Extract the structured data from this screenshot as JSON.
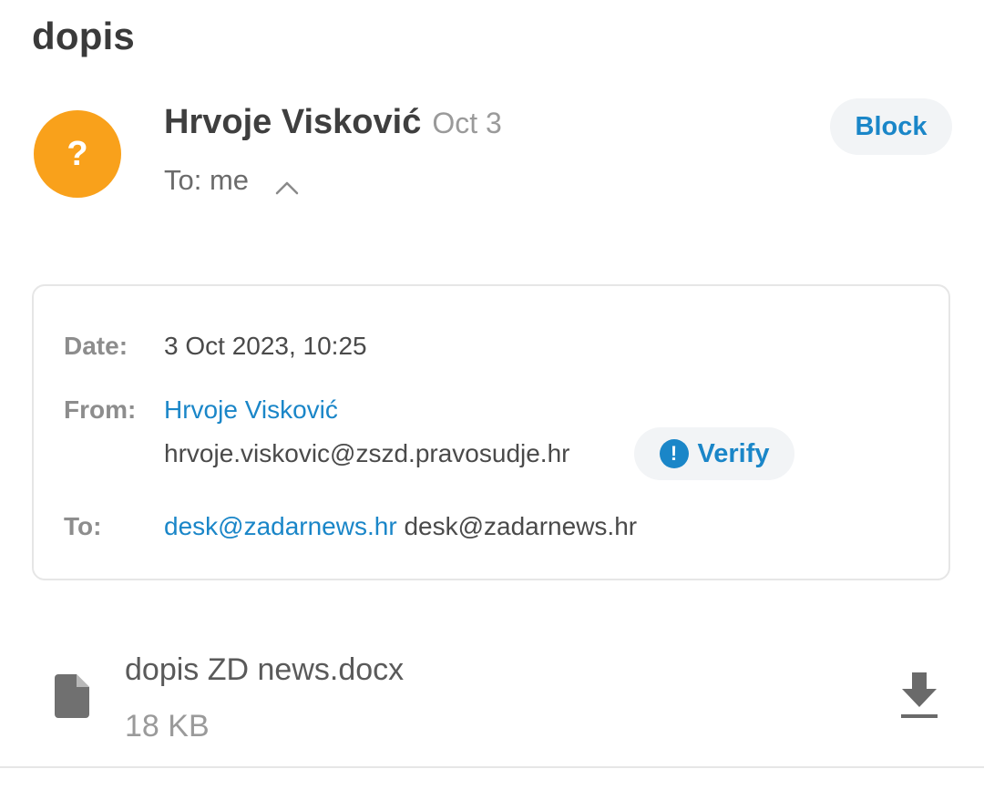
{
  "email": {
    "subject": "dopis",
    "sender": {
      "avatar_glyph": "?",
      "avatar_color": "#f9a11b",
      "name": "Hrvoje Visković",
      "date_short": "Oct 3"
    },
    "recipient_summary": "To: me",
    "actions": {
      "block_label": "Block",
      "verify_label": "Verify"
    },
    "details": {
      "date_label": "Date:",
      "date_value": "3 Oct 2023, 10:25",
      "from_label": "From:",
      "from_name": "Hrvoje Visković",
      "from_address": "hrvoje.viskovic@zszd.pravosudje.hr",
      "to_label": "To:",
      "to_link": "desk@zadarnews.hr",
      "to_address": "desk@zadarnews.hr"
    },
    "attachment": {
      "file_name": "dopis ZD news.docx",
      "file_size": "18 KB",
      "icons": [
        "file-icon",
        "download-icon"
      ]
    }
  },
  "colors": {
    "accent": "#1a86c8",
    "avatar": "#f9a11b"
  }
}
